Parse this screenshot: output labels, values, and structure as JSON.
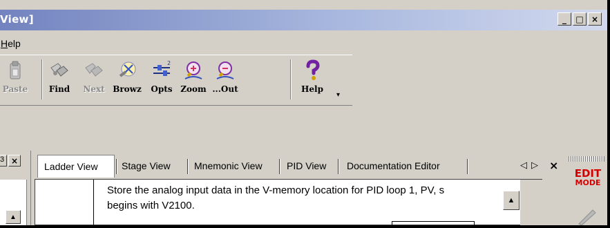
{
  "window": {
    "title": "View]",
    "buttons": {
      "minimize": "_",
      "maximize": "□",
      "close": "×"
    }
  },
  "menu": {
    "items": [
      "Help"
    ]
  },
  "toolbar": {
    "buttons": [
      {
        "label": "Paste",
        "icon": "paste-icon",
        "enabled": false
      },
      {
        "label": "Find",
        "icon": "find-binoculars-icon",
        "enabled": true
      },
      {
        "label": "Next",
        "icon": "find-next-icon",
        "enabled": false
      },
      {
        "label": "Browz",
        "icon": "browse-icon",
        "enabled": true
      },
      {
        "label": "Opts",
        "icon": "options-icon",
        "enabled": true
      },
      {
        "label": "Zoom",
        "icon": "zoom-in-icon",
        "enabled": true
      },
      {
        "label": "...Out",
        "icon": "zoom-out-icon",
        "enabled": true
      },
      {
        "label": "Help",
        "icon": "help-question-icon",
        "enabled": true
      }
    ],
    "help_dropdown_arrow": "▾"
  },
  "left_panel": {
    "close": "×",
    "fragment": "3",
    "scroll_up": "▲"
  },
  "tabs": [
    {
      "label": "Ladder View",
      "active": true
    },
    {
      "label": "Stage View",
      "active": false
    },
    {
      "label": "Mnemonic View",
      "active": false
    },
    {
      "label": "PID View",
      "active": false
    },
    {
      "label": "Documentation Editor",
      "active": false
    }
  ],
  "tab_nav": {
    "prev": "◁",
    "next": "▷",
    "close": "×"
  },
  "editor": {
    "comment_line1": "Store the analog input data in the V-memory location for PID loop 1, PV, s",
    "comment_line2": "begins with V2100.",
    "scroll_up": "▲"
  },
  "mode_indicator": {
    "line1": "EDIT",
    "line2": "MODE",
    "color": "#d40000"
  },
  "colors": {
    "title_start": "#7383bf",
    "title_end": "#d2d9ee",
    "face": "#d4d0c8"
  }
}
